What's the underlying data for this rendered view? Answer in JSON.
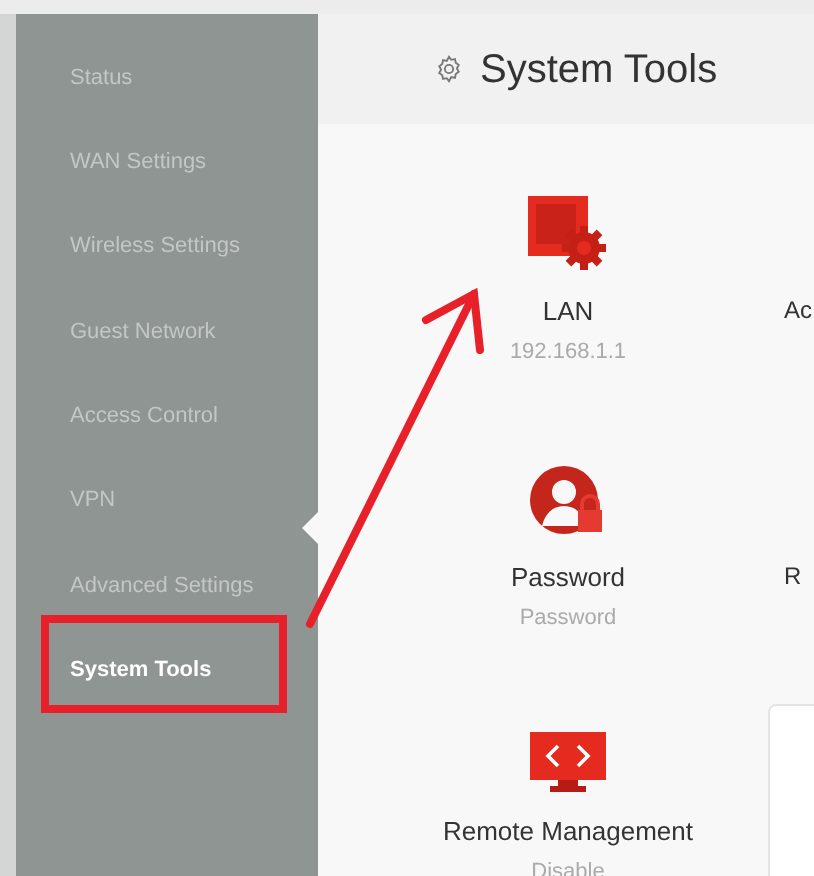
{
  "sidebar": {
    "items": [
      {
        "label": "Status",
        "selected": false
      },
      {
        "label": "WAN Settings",
        "selected": false
      },
      {
        "label": "Wireless Settings",
        "selected": false
      },
      {
        "label": "Guest Network",
        "selected": false
      },
      {
        "label": "Access Control",
        "selected": false
      },
      {
        "label": "VPN",
        "selected": false
      },
      {
        "label": "Advanced Settings",
        "selected": false
      },
      {
        "label": "System Tools",
        "selected": true
      }
    ]
  },
  "header": {
    "title": "System Tools"
  },
  "tiles": [
    [
      {
        "kind": "tile",
        "label": "LAN",
        "sub": "192.168.1.1"
      },
      {
        "kind": "partial",
        "label": "Ac"
      }
    ],
    [
      {
        "kind": "tile",
        "label": "Password",
        "sub": "Password"
      },
      {
        "kind": "partial",
        "label": "R"
      }
    ],
    [
      {
        "kind": "tile",
        "label": "Remote Management",
        "sub": "Disable"
      },
      {
        "kind": "panel"
      }
    ]
  ]
}
